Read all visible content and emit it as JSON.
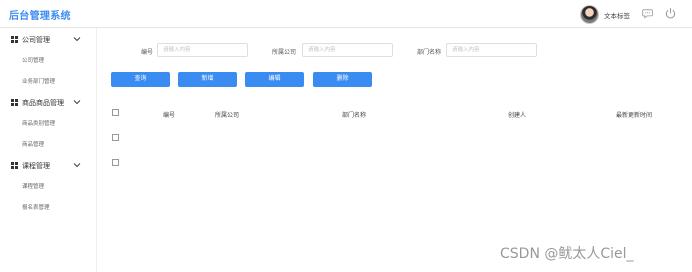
{
  "header": {
    "brand": "后台管理系统",
    "username": "文本标签",
    "icons": [
      "avatar",
      "message-icon",
      "power-icon"
    ]
  },
  "sidebar": {
    "groups": [
      {
        "title": "公司管理",
        "items": [
          "公司管理",
          "业务部门管理"
        ]
      },
      {
        "title": "商品商品管理",
        "items": [
          "商品类别管理",
          "商品管理"
        ]
      },
      {
        "title": "课程管理",
        "items": [
          "课程管理",
          "报名表管理"
        ]
      }
    ]
  },
  "filters": [
    {
      "label": "编号",
      "placeholder": "请输入内容"
    },
    {
      "label": "所属公司",
      "placeholder": "请输入内容"
    },
    {
      "label": "部门名称",
      "placeholder": "请输入内容"
    }
  ],
  "buttons": [
    "查询",
    "新增",
    "编辑",
    "删除"
  ],
  "table": {
    "headers": [
      "编号",
      "所属公司",
      "部门名称",
      "创建人",
      "最新更新时间"
    ],
    "row_count": 2
  },
  "watermark": "CSDN @鱿太人Ciel_",
  "colors": {
    "accent": "#3b8cf2",
    "border": "#dcdfe6"
  }
}
